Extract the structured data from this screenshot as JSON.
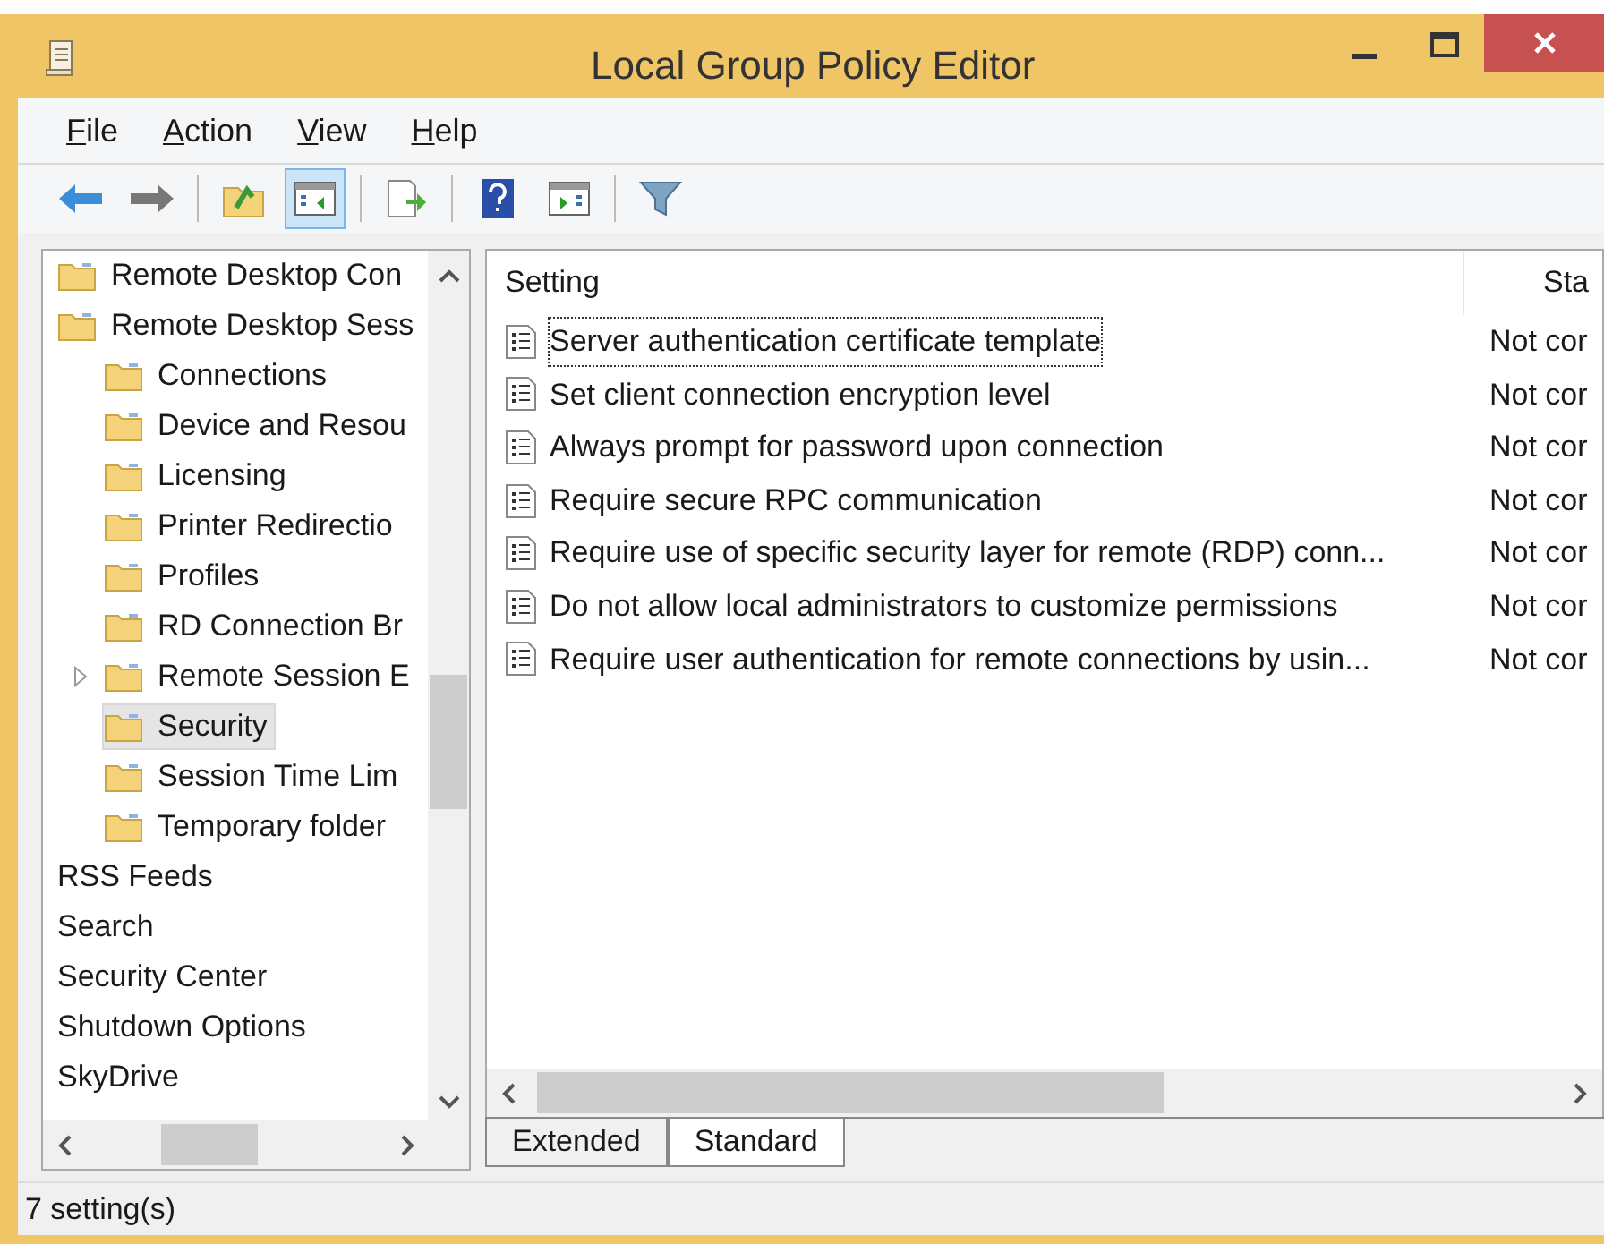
{
  "window": {
    "title": "Local Group Policy Editor"
  },
  "menu": [
    {
      "label": "File"
    },
    {
      "label": "Action"
    },
    {
      "label": "View"
    },
    {
      "label": "Help"
    }
  ],
  "toolbar": [
    {
      "kind": "back",
      "selected": false
    },
    {
      "kind": "forward",
      "selected": false
    },
    {
      "kind": "sep"
    },
    {
      "kind": "up",
      "selected": false
    },
    {
      "kind": "pane",
      "selected": true
    },
    {
      "kind": "sep"
    },
    {
      "kind": "export",
      "selected": false
    },
    {
      "kind": "sep"
    },
    {
      "kind": "help",
      "selected": false
    },
    {
      "kind": "pane2",
      "selected": false
    },
    {
      "kind": "sep"
    },
    {
      "kind": "filter",
      "selected": false
    }
  ],
  "tree": [
    {
      "label": "Remote Desktop Con",
      "kind": "folder",
      "selected": false
    },
    {
      "label": "Remote Desktop Sess",
      "kind": "folder",
      "selected": false,
      "children": [
        {
          "label": "Connections",
          "expandable": false,
          "selected": false
        },
        {
          "label": "Device and Resou",
          "expandable": false,
          "selected": false
        },
        {
          "label": "Licensing",
          "expandable": false,
          "selected": false
        },
        {
          "label": "Printer Redirectio",
          "expandable": false,
          "selected": false
        },
        {
          "label": "Profiles",
          "expandable": false,
          "selected": false
        },
        {
          "label": "RD Connection Br",
          "expandable": false,
          "selected": false
        },
        {
          "label": "Remote Session E",
          "expandable": true,
          "selected": false
        },
        {
          "label": "Security",
          "expandable": false,
          "selected": true
        },
        {
          "label": "Session Time Lim",
          "expandable": false,
          "selected": false
        },
        {
          "label": "Temporary folder",
          "expandable": false,
          "selected": false
        }
      ]
    },
    {
      "label": "RSS Feeds",
      "kind": "plain",
      "selected": false
    },
    {
      "label": "Search",
      "kind": "plain",
      "selected": false
    },
    {
      "label": "Security Center",
      "kind": "plain",
      "selected": false
    },
    {
      "label": "Shutdown Options",
      "kind": "plain",
      "selected": false
    },
    {
      "label": "SkyDrive",
      "kind": "plain",
      "selected": false
    }
  ],
  "table": {
    "columns": [
      "Setting",
      "Sta"
    ],
    "rows": [
      {
        "setting": "Server authentication certificate template",
        "state": "Not cor",
        "focused": true
      },
      {
        "setting": "Set client connection encryption level",
        "state": "Not cor",
        "focused": false
      },
      {
        "setting": "Always prompt for password upon connection",
        "state": "Not cor",
        "focused": false
      },
      {
        "setting": "Require secure RPC communication",
        "state": "Not cor",
        "focused": false
      },
      {
        "setting": "Require use of specific security layer for remote (RDP) conn...",
        "state": "Not cor",
        "focused": false
      },
      {
        "setting": "Do not allow local administrators to customize permissions",
        "state": "Not cor",
        "focused": false
      },
      {
        "setting": "Require user authentication for remote connections by usin...",
        "state": "Not cor",
        "focused": false
      }
    ]
  },
  "tabs": [
    {
      "label": "Extended",
      "selected": false
    },
    {
      "label": "Standard",
      "selected": true
    }
  ],
  "status_bar": "7 setting(s)"
}
